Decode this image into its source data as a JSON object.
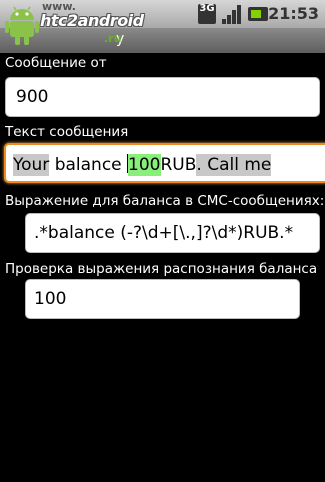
{
  "status_bar": {
    "network": "3G",
    "time": "21:53"
  },
  "watermark": {
    "line1": "www.",
    "line2": "htc2android",
    "line3": ".ru"
  },
  "title_bar": {
    "title_fragment": "y"
  },
  "form": {
    "sender": {
      "label": "Сообщение от",
      "value": "900"
    },
    "message": {
      "label": "Текст сообщения",
      "parts": [
        "Your",
        " balance ",
        "100",
        "RUB",
        ". Call me"
      ]
    },
    "regex": {
      "label": "Выражение для баланса в СМС-сообщениях:",
      "value": ".*balance (-?\\d+[\\.,]?\\d*)RUB.*"
    },
    "check": {
      "label": "Проверка выражения распознания баланса",
      "value": "100"
    }
  }
}
